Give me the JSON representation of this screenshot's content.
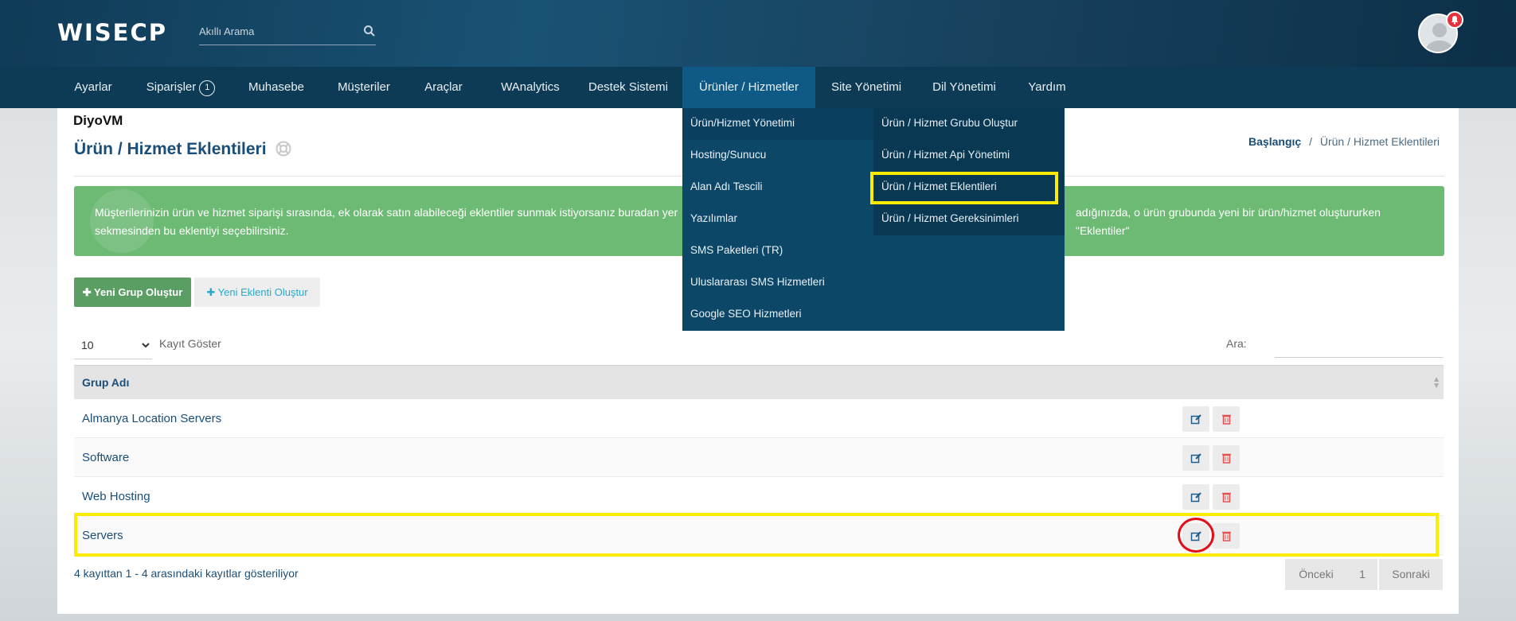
{
  "header": {
    "logo": "WISECP",
    "search_placeholder": "Akıllı Arama"
  },
  "nav": {
    "items": [
      {
        "label": "Ayarlar"
      },
      {
        "label": "Siparişler",
        "badge": "1"
      },
      {
        "label": "Muhasebe"
      },
      {
        "label": "Müşteriler"
      },
      {
        "label": "Araçlar"
      },
      {
        "label": "WAnalytics"
      },
      {
        "label": "Destek Sistemi"
      },
      {
        "label": "Ürünler / Hizmetler"
      },
      {
        "label": "Site Yönetimi"
      },
      {
        "label": "Dil Yönetimi"
      },
      {
        "label": "Yardım"
      }
    ],
    "active_item": "Ürünler / Hizmetler"
  },
  "dropdown": {
    "left": [
      "Ürün/Hizmet Yönetimi",
      "Hosting/Sunucu",
      "Alan Adı Tescili",
      "Yazılımlar",
      "SMS Paketleri (TR)",
      "Uluslararası SMS Hizmetleri",
      "Google SEO Hizmetleri"
    ],
    "right": [
      "Ürün / Hizmet Grubu Oluştur",
      "Ürün / Hizmet Api Yönetimi",
      "Ürün / Hizmet Eklentileri",
      "Ürün / Hizmet Gereksinimleri"
    ]
  },
  "page": {
    "account": "DiyoVM",
    "title": "Ürün / Hizmet Eklentileri",
    "breadcrumb": {
      "home": "Başlangıç",
      "separator": "/",
      "current": "Ürün / Hizmet Eklentileri"
    },
    "info_line1": "Müşterilerinizin ürün ve hizmet siparişi sırasında, ek olarak satın alabileceği eklentiler sunmak istiyorsanız buradan yer",
    "info_line1_end": "adığınızda, o ürün grubunda yeni bir ürün/hizmet oluştururken \"Eklentiler\"",
    "info_line2": "sekmesinden bu eklentiyi seçebilirsiniz.",
    "btn_new_group": "Yeni Grup Oluştur",
    "btn_new_addon": "Yeni Eklenti Oluştur",
    "length_value": "10",
    "length_label": "Kayıt Göster",
    "search_label": "Ara:"
  },
  "table": {
    "column": "Grup Adı",
    "rows": [
      "Almanya Location Servers",
      "Software",
      "Web Hosting",
      "Servers"
    ]
  },
  "footer": {
    "info": "4 kayıttan 1 - 4 arasındaki kayıtlar gösteriliyor",
    "prev": "Önceki",
    "page": "1",
    "next": "Sonraki"
  },
  "colors": {
    "highlight": "#ffeb00",
    "circle": "#e0101a",
    "info_green": "#6cba73",
    "nav": "#0d3b56"
  }
}
